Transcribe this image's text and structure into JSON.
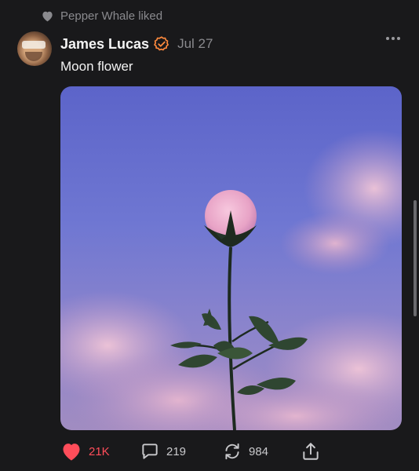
{
  "liked_by": {
    "text": "Pepper Whale liked"
  },
  "post": {
    "author": "James Lucas",
    "date": "Jul 27",
    "text": "Moon flower",
    "media_description": "pink-moon-rose-photo"
  },
  "actions": {
    "likes": "21K",
    "replies": "219",
    "reposts": "984"
  },
  "colors": {
    "background": "#19191b",
    "accent": "#ff8a3d",
    "like": "#ff4d5a",
    "muted": "#8a8a8e"
  },
  "icons": [
    "heart-icon",
    "verified-badge-icon",
    "more-options-icon",
    "comment-icon",
    "repost-icon",
    "share-icon"
  ]
}
